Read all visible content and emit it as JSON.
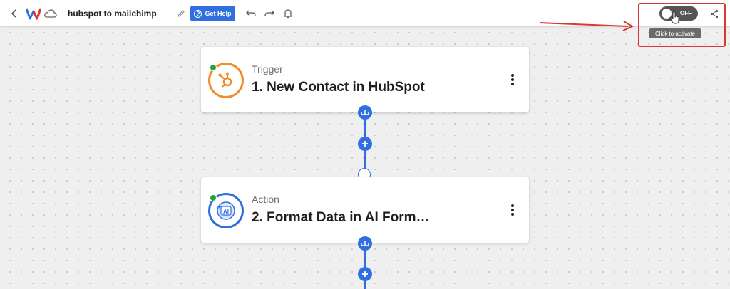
{
  "header": {
    "title": "hubspot to mailchimp",
    "help_label": "Get Help"
  },
  "activation": {
    "toggle_label": "OFF",
    "tooltip": "Click to activate"
  },
  "steps": [
    {
      "kind": "Trigger",
      "name": "1. New Contact in HubSpot",
      "icon": "hubspot-icon"
    },
    {
      "kind": "Action",
      "name": "2. Format Data in AI Form…",
      "icon": "ai-formatter-icon",
      "icon_text": "AI"
    }
  ],
  "colors": {
    "accent": "#2f6fe0",
    "hubspot": "#f28c28",
    "status": "#2aa336",
    "highlight": "#d9382e"
  }
}
